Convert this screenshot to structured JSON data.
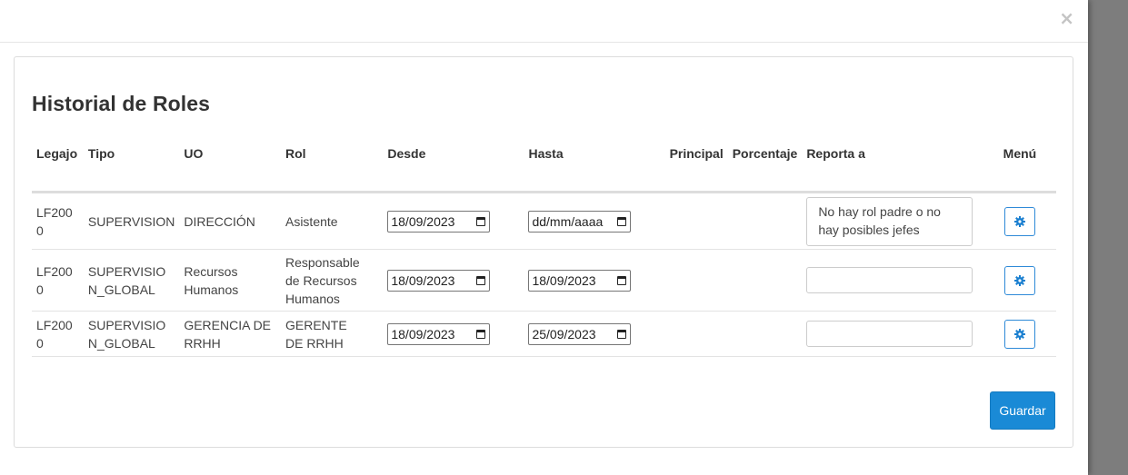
{
  "dialog": {
    "close_label": "×"
  },
  "title": "Historial de Roles",
  "table": {
    "headers": {
      "legajo": "Legajo",
      "tipo": "Tipo",
      "uo": "UO",
      "rol": "Rol",
      "desde": "Desde",
      "hasta": "Hasta",
      "principal": "Principal",
      "porcentaje": "Porcentaje",
      "reporta": "Reporta a",
      "menu": "Menú"
    },
    "rows": [
      {
        "legajo": "LF2000",
        "tipo": "SUPERVISION",
        "uo": "DIRECCIÓN",
        "rol": "Asistente",
        "desde": "18/09/2023",
        "hasta": "dd/mm/aaaa",
        "principal": "",
        "porcentaje": "",
        "reporta": "No hay rol padre o no hay posibles jefes"
      },
      {
        "legajo": "LF2000",
        "tipo": "SUPERVISION_GLOBAL",
        "uo": "Recursos Humanos",
        "rol": "Responsable de Recursos Humanos",
        "desde": "18/09/2023",
        "hasta": "18/09/2023",
        "principal": "",
        "porcentaje": "",
        "reporta": ""
      },
      {
        "legajo": "LF2000",
        "tipo": "SUPERVISION_GLOBAL",
        "uo": "GERENCIA DE RRHH",
        "rol": "GERENTE DE RRHH",
        "desde": "18/09/2023",
        "hasta": "25/09/2023",
        "principal": "",
        "porcentaje": "",
        "reporta": ""
      }
    ]
  },
  "actions": {
    "save_label": "Guardar"
  },
  "icons": {
    "close": "close-icon",
    "calendar": "calendar-icon",
    "menu": "gear-icon"
  },
  "colors": {
    "primary": "#1a8ad6",
    "outline": "#2e8ad8",
    "backdrop": "#7d7d7d"
  }
}
